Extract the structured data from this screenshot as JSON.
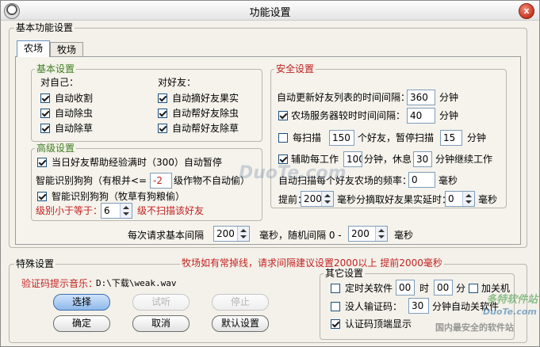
{
  "window": {
    "title": "功能设置",
    "close_glyph": "x"
  },
  "basic": {
    "group_title": "基本功能设置",
    "tabs": [
      "农场",
      "牧场"
    ],
    "basic_settings": {
      "title": "基本设置",
      "self_header": "对自己：",
      "self_items": [
        {
          "label": "自动收割",
          "checked": true
        },
        {
          "label": "自动除虫",
          "checked": true
        },
        {
          "label": "自动除草",
          "checked": true
        }
      ],
      "friend_header": "对好友：",
      "friend_items": [
        {
          "label": "自动摘好友果实",
          "checked": true
        },
        {
          "label": "自动帮好友除虫",
          "checked": true
        },
        {
          "label": "自动帮好友除草",
          "checked": true
        }
      ]
    },
    "advanced": {
      "title": "高级设置",
      "help_exp_label": "当日好友帮助经验满时（300）自动暂停",
      "dog_root_label": "智能识别狗狗（有根并<=",
      "dog_root_value": "-2",
      "dog_root_suffix": "级作物不自动偷）",
      "dog_food_label": "智能识别狗狗（牧草有狗粮偷）",
      "level_label": "级别小于等于：",
      "level_value": "6",
      "level_suffix": "级不扫描该好友"
    },
    "security": {
      "title": "安全设置",
      "refresh_label": "自动更新好友列表的时间间隔：",
      "refresh_value": "360",
      "refresh_unit": "分钟",
      "sync_label": "农场服务器较时时间间隔：",
      "sync_value": "40",
      "sync_unit": "分钟",
      "scan_prefix": "每扫描",
      "scan_value": "150",
      "scan_mid": "个好友，暂停扫描",
      "pause_value": "15",
      "pause_unit": "分钟",
      "assist_prefix": "辅助每工作",
      "assist_work": "100",
      "assist_mid": "分钟，休息",
      "assist_rest": "30",
      "assist_suffix": "分钟继续工作",
      "freq_label": "自动扫描每个好友农场的频率：",
      "freq_value": "0",
      "freq_unit": "毫秒",
      "advance_label": "提前：",
      "advance_value": "200",
      "advance_mid": "毫秒分摘取好友果实延时：",
      "delay_value": "0",
      "delay_unit": "毫秒"
    },
    "request_row": {
      "label": "每次请求基本间隔",
      "base_value": "200",
      "mid": "毫秒，随机间隔 0 -",
      "random_value": "200",
      "unit": "毫秒"
    }
  },
  "special": {
    "group_title": "特殊设置",
    "warning": "牧场如有常掉线，请求间隔建议设置2000以上 提前2000毫秒",
    "music_label": "验证码提示音乐：",
    "music_path": "D:\\下载\\weak.wav",
    "buttons": {
      "choose": "选择",
      "listen": "试听",
      "stop": "停止",
      "ok": "确定",
      "cancel": "取消",
      "default": "默认设置"
    },
    "other": {
      "title": "其它设置",
      "timer_label": "定时关软件",
      "hour_value": "00",
      "hour_unit": "时",
      "minute_value": "00",
      "minute_unit": "分",
      "shutdown_label": "加关机",
      "noinput_label": "没人输证码：",
      "noinput_value": "30",
      "noinput_suffix": "分钟自动关软件",
      "captcha_top_label": "认证码顶端显示"
    }
  },
  "watermarks": {
    "center": "DuoTe.com",
    "corner_title": "多特软件站",
    "corner_url": "DuoTe.com",
    "corner_sub": "国内最安全的软件站"
  }
}
